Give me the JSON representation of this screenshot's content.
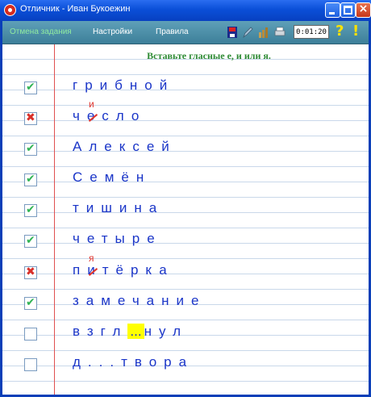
{
  "window": {
    "title": "Отличник - Иван Букоежин"
  },
  "toolbar": {
    "menu": [
      "Отмена задания",
      "Настройки",
      "Правила"
    ],
    "timer": "0:01:20",
    "help_glyph": "?",
    "warn_glyph": "!"
  },
  "task": {
    "instruction": "Вставьте гласные е, и или я."
  },
  "rows": [
    {
      "status": "ok",
      "word": "грибной"
    },
    {
      "status": "bad",
      "word": "чесло",
      "correction": "и"
    },
    {
      "status": "ok",
      "word": "Алексей"
    },
    {
      "status": "ok",
      "word": "Семён"
    },
    {
      "status": "ok",
      "word": "тишина"
    },
    {
      "status": "ok",
      "word": "четыре"
    },
    {
      "status": "bad",
      "word": "питёрка",
      "correction": "я"
    },
    {
      "status": "ok",
      "word": "замечание"
    },
    {
      "status": "empty",
      "word_pre": "взгл",
      "blank": "...",
      "word_post": "нул"
    },
    {
      "status": "empty",
      "word": "д...твора"
    }
  ],
  "colors": {
    "accent_green": "#32b456",
    "error_red": "#d8302a",
    "word_blue": "#1a35c8"
  }
}
